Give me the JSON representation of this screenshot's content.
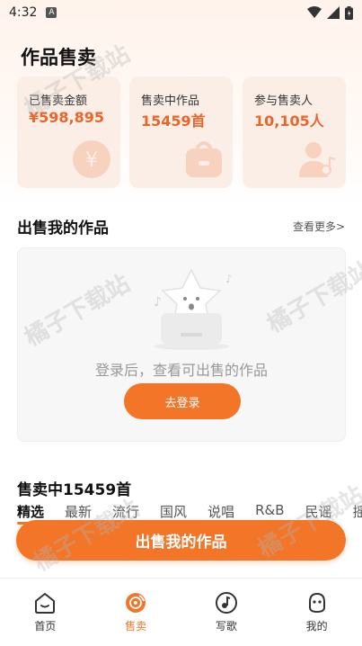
{
  "status_bar": {
    "time": "4:32",
    "notification_letter": "A"
  },
  "page": {
    "title": "作品售卖"
  },
  "stats": [
    {
      "label": "已售卖金额",
      "value": "¥598,895",
      "icon": "yen-coin-icon"
    },
    {
      "label": "售卖中作品",
      "value": "15459首",
      "icon": "shop-bag-icon"
    },
    {
      "label": "参与售卖人",
      "value": "10,105人",
      "icon": "person-music-icon"
    }
  ],
  "my_works": {
    "title": "出售我的作品",
    "view_more": "查看更多>",
    "empty_text": "登录后，查看可出售的作品",
    "login_button": "去登录"
  },
  "selling": {
    "title": "售卖中15459首",
    "tabs": [
      "精选",
      "最新",
      "流行",
      "国风",
      "说唱",
      "R&B",
      "民谣",
      "摇"
    ],
    "active_tab": "精选"
  },
  "sell_button": "出售我的作品",
  "bottom_nav": [
    {
      "label": "首页",
      "icon": "home-icon",
      "active": false
    },
    {
      "label": "售卖",
      "icon": "record-icon",
      "active": true
    },
    {
      "label": "写歌",
      "icon": "pen-note-icon",
      "active": false
    },
    {
      "label": "我的",
      "icon": "face-icon",
      "active": false
    }
  ],
  "watermark": "橘子下载站",
  "colors": {
    "accent": "#f27528",
    "stat_value": "#e8662a",
    "card_bg": "#fbeee6"
  }
}
